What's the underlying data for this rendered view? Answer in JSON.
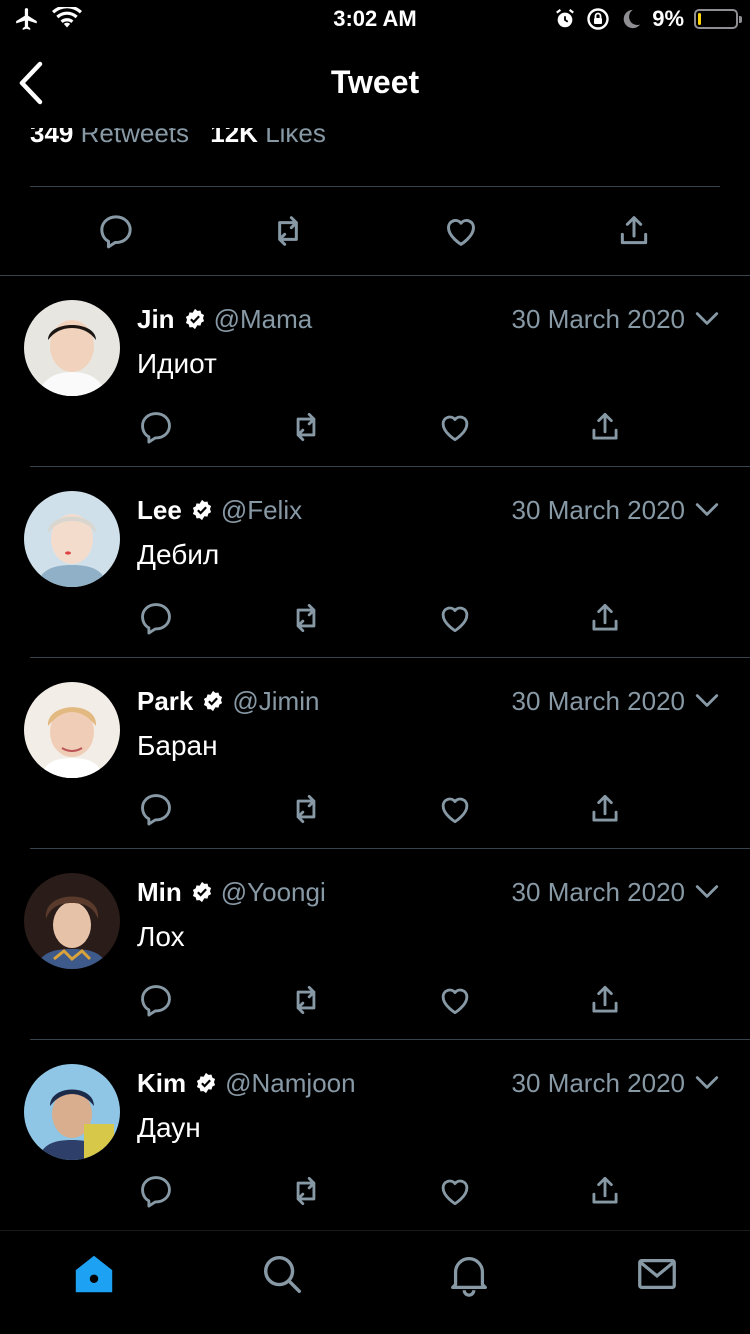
{
  "status_bar": {
    "time": "3:02 AM",
    "battery": "9%",
    "battery_level": 0.09
  },
  "header": {
    "title": "Tweet"
  },
  "stats": {
    "retweets_count": "349",
    "retweets_label": "Retweets",
    "likes_count": "12K",
    "likes_label": "Likes"
  },
  "colors": {
    "background": "#000000",
    "secondary_text": "#8899a6",
    "accent": "#1da1f2",
    "divider": "#38444d",
    "battery_low": "#ffd60a"
  },
  "replies": [
    {
      "name": "Jin",
      "handle": "@Mama",
      "date": "30 March 2020",
      "text": "Идиот"
    },
    {
      "name": "Lee",
      "handle": "@Felix",
      "date": "30 March 2020",
      "text": "Дебил"
    },
    {
      "name": "Park",
      "handle": "@Jimin",
      "date": "30 March 2020",
      "text": "Баран"
    },
    {
      "name": "Min",
      "handle": "@Yoongi",
      "date": "30 March 2020",
      "text": "Лох"
    },
    {
      "name": "Kim",
      "handle": "@Namjoon",
      "date": "30 March 2020",
      "text": "Даун"
    }
  ],
  "tabbar": {
    "items": [
      "home-icon",
      "search-icon",
      "bell-icon",
      "mail-icon"
    ],
    "active": "home-icon"
  }
}
